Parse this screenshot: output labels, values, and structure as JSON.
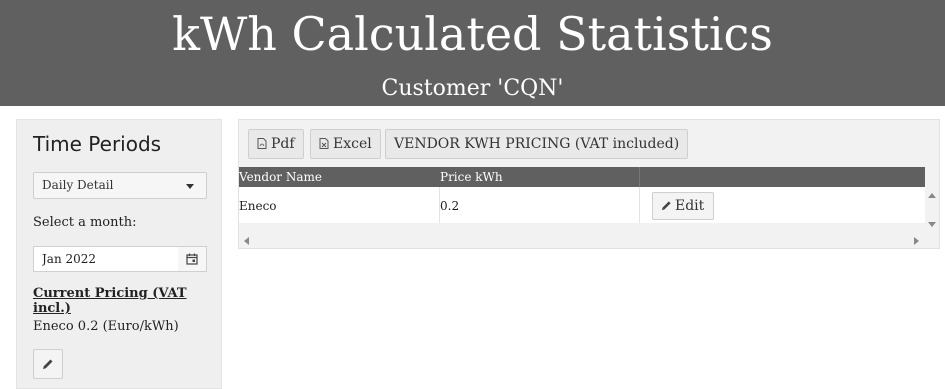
{
  "header": {
    "title": "kWh Calculated Statistics",
    "subtitle": "Customer 'CQN'"
  },
  "sidebar": {
    "panel_title": "Time Periods",
    "period_select": {
      "selected": "Daily Detail"
    },
    "month_label": "Select a month:",
    "month_input": {
      "value": "Jan 2022"
    },
    "pricing_title": "Current Pricing (VAT incl.)",
    "pricing_value": "Eneco 0.2 (Euro/kWh)"
  },
  "toolbar": {
    "pdf_label": "Pdf",
    "excel_label": "Excel",
    "pricing_label": "VENDOR KWH PRICING (VAT included)"
  },
  "table": {
    "columns": [
      "Vendor Name",
      "Price kWh",
      ""
    ],
    "rows": [
      {
        "vendor": "Eneco",
        "price": "0.2",
        "action_label": "Edit"
      }
    ]
  },
  "colors": {
    "header_bg": "#606060",
    "sidebar_bg": "#efefef",
    "table_header_bg": "#606060"
  }
}
